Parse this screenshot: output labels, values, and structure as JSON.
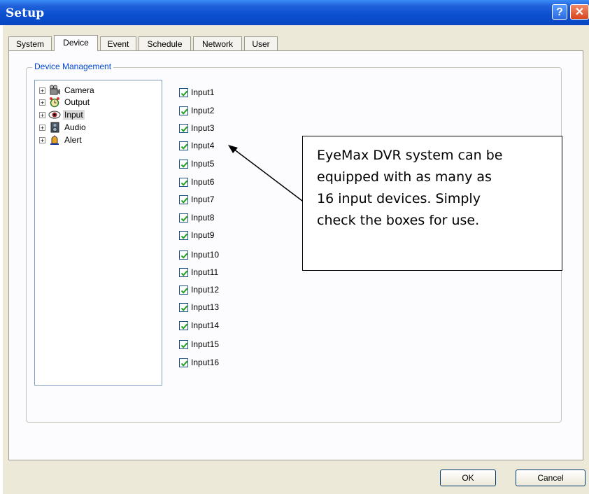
{
  "window": {
    "title": "Setup",
    "help_label": "?",
    "close_label": "✕"
  },
  "tabs": [
    {
      "label": "System",
      "active": false
    },
    {
      "label": "Device",
      "active": true
    },
    {
      "label": "Event",
      "active": false
    },
    {
      "label": "Schedule",
      "active": false
    },
    {
      "label": "Network",
      "active": false
    },
    {
      "label": "User",
      "active": false
    }
  ],
  "group": {
    "title": "Device Management"
  },
  "tree": [
    {
      "label": "Camera",
      "icon": "camera-icon",
      "expander": "+"
    },
    {
      "label": "Output",
      "icon": "alarm-clock-icon",
      "expander": "+"
    },
    {
      "label": "Input",
      "icon": "eye-icon",
      "expander": "+",
      "selected": true
    },
    {
      "label": "Audio",
      "icon": "speaker-icon",
      "expander": "+"
    },
    {
      "label": "Alert",
      "icon": "siren-icon",
      "expander": "+"
    }
  ],
  "inputs": [
    {
      "label": "Input1",
      "checked": true
    },
    {
      "label": "Input2",
      "checked": true
    },
    {
      "label": "Input3",
      "checked": true
    },
    {
      "label": "Input4",
      "checked": true
    },
    {
      "label": "Input5",
      "checked": true
    },
    {
      "label": "Input6",
      "checked": true
    },
    {
      "label": "Input7",
      "checked": true
    },
    {
      "label": "Input8",
      "checked": true
    },
    {
      "label": "Input9",
      "checked": true
    },
    {
      "label": "Input10",
      "checked": true
    },
    {
      "label": "Input11",
      "checked": true
    },
    {
      "label": "Input12",
      "checked": true
    },
    {
      "label": "Input13",
      "checked": true
    },
    {
      "label": "Input14",
      "checked": true
    },
    {
      "label": "Input15",
      "checked": true
    },
    {
      "label": "Input16",
      "checked": true
    }
  ],
  "callout": {
    "lines": [
      "EyeMax DVR system can be",
      "equipped with as many as",
      "16 input devices. Simply",
      "check the boxes for use."
    ]
  },
  "buttons": {
    "ok": "OK",
    "cancel": "Cancel"
  },
  "colors": {
    "titlebar": "#0a4fd0",
    "client": "#ece9d8",
    "legend": "#0046d5",
    "checkmark": "#21a121"
  }
}
